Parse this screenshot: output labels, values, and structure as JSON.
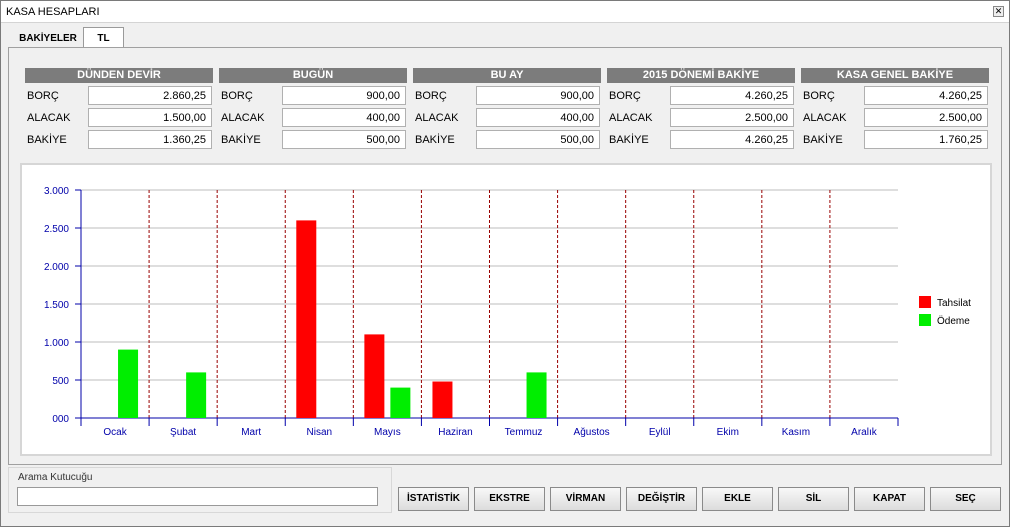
{
  "window": {
    "title": "KASA HESAPLARI",
    "close_glyph": "✕"
  },
  "tabs": [
    {
      "label": "BAKİYELER"
    },
    {
      "label": "TL"
    }
  ],
  "summary": [
    {
      "header": "DÜNDEN DEVİR",
      "rows": [
        {
          "label": "BORÇ",
          "value": "2.860,25"
        },
        {
          "label": "ALACAK",
          "value": "1.500,00"
        },
        {
          "label": "BAKİYE",
          "value": "1.360,25"
        }
      ]
    },
    {
      "header": "BUGÜN",
      "rows": [
        {
          "label": "BORÇ",
          "value": "900,00"
        },
        {
          "label": "ALACAK",
          "value": "400,00"
        },
        {
          "label": "BAKİYE",
          "value": "500,00"
        }
      ]
    },
    {
      "header": "BU AY",
      "rows": [
        {
          "label": "BORÇ",
          "value": "900,00"
        },
        {
          "label": "ALACAK",
          "value": "400,00"
        },
        {
          "label": "BAKİYE",
          "value": "500,00"
        }
      ]
    },
    {
      "header": "2015 DÖNEMİ BAKİYE",
      "rows": [
        {
          "label": "BORÇ",
          "value": "4.260,25"
        },
        {
          "label": "ALACAK",
          "value": "2.500,00"
        },
        {
          "label": "BAKİYE",
          "value": "4.260,25"
        }
      ]
    },
    {
      "header": "KASA GENEL BAKİYE",
      "rows": [
        {
          "label": "BORÇ",
          "value": "4.260,25"
        },
        {
          "label": "ALACAK",
          "value": "2.500,00"
        },
        {
          "label": "BAKİYE",
          "value": "1.760,25"
        }
      ]
    }
  ],
  "chart_data": {
    "type": "bar",
    "categories": [
      "Ocak",
      "Şubat",
      "Mart",
      "Nisan",
      "Mayıs",
      "Haziran",
      "Temmuz",
      "Ağustos",
      "Eylül",
      "Ekim",
      "Kasım",
      "Aralık"
    ],
    "series": [
      {
        "name": "Tahsilat",
        "color": "#ff0000",
        "values": [
          0,
          0,
          0,
          2600,
          1100,
          480,
          0,
          0,
          0,
          0,
          0,
          0
        ]
      },
      {
        "name": "Ödeme",
        "color": "#00ee00",
        "values": [
          900,
          600,
          0,
          0,
          400,
          0,
          600,
          0,
          0,
          0,
          0,
          0
        ]
      }
    ],
    "ylim": [
      0,
      3000
    ],
    "yticks": [
      {
        "value": 0,
        "label": "000"
      },
      {
        "value": 500,
        "label": "500"
      },
      {
        "value": 1000,
        "label": "1.000"
      },
      {
        "value": 1500,
        "label": "1.500"
      },
      {
        "value": 2000,
        "label": "2.000"
      },
      {
        "value": 2500,
        "label": "2.500"
      },
      {
        "value": 3000,
        "label": "3.000"
      }
    ],
    "grid": true,
    "legend": "right",
    "axis_color": "#0000aa",
    "separator_color": "#990000"
  },
  "search": {
    "label": "Arama Kutucuğu",
    "value": "",
    "placeholder": ""
  },
  "buttons": [
    {
      "key": "istatistik",
      "label": "İSTATİSTİK"
    },
    {
      "key": "ekstre",
      "label": "EKSTRE"
    },
    {
      "key": "virman",
      "label": "VİRMAN"
    },
    {
      "key": "degistir",
      "label": "DEĞİŞTİR"
    },
    {
      "key": "ekle",
      "label": "EKLE"
    },
    {
      "key": "sil",
      "label": "SİL"
    },
    {
      "key": "kapat",
      "label": "KAPAT"
    },
    {
      "key": "sec",
      "label": "SEÇ"
    }
  ]
}
